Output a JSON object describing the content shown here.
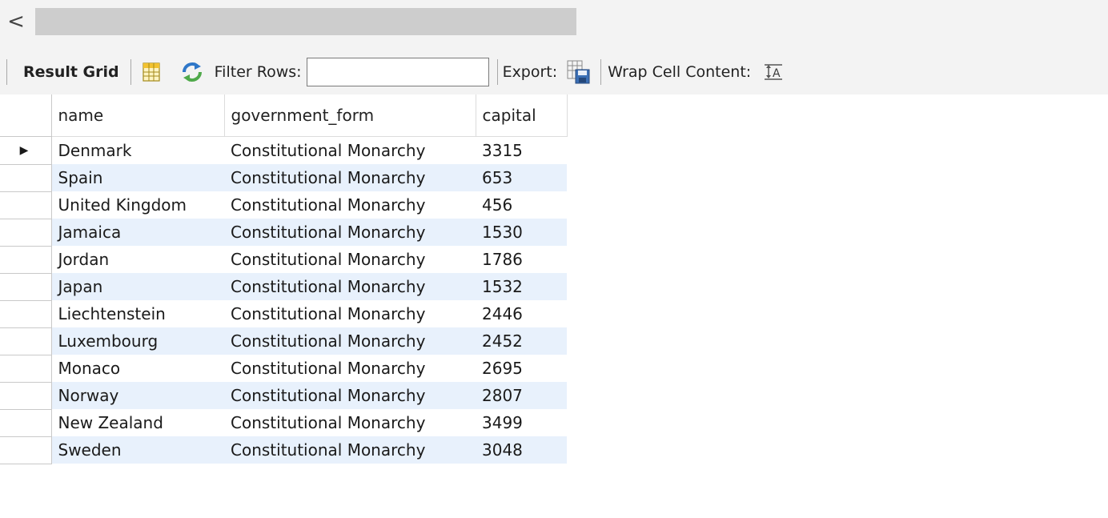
{
  "scrollbar": {
    "left_arrow": "<"
  },
  "toolbar": {
    "result_grid_label": "Result Grid",
    "filter_rows_label": "Filter Rows:",
    "filter_rows_value": "",
    "export_label": "Export:",
    "wrap_cell_label": "Wrap Cell Content:",
    "icons": [
      "grid-layout-icon",
      "refresh-icon",
      "export-icon",
      "wrap-text-icon"
    ]
  },
  "grid": {
    "columns": [
      "name",
      "government_form",
      "capital"
    ],
    "current_row_marker": "▶",
    "rows": [
      {
        "name": "Denmark",
        "government_form": "Constitutional Monarchy",
        "capital": "3315"
      },
      {
        "name": "Spain",
        "government_form": "Constitutional Monarchy",
        "capital": "653"
      },
      {
        "name": "United Kingdom",
        "government_form": "Constitutional Monarchy",
        "capital": "456"
      },
      {
        "name": "Jamaica",
        "government_form": "Constitutional Monarchy",
        "capital": "1530"
      },
      {
        "name": "Jordan",
        "government_form": "Constitutional Monarchy",
        "capital": "1786"
      },
      {
        "name": "Japan",
        "government_form": "Constitutional Monarchy",
        "capital": "1532"
      },
      {
        "name": "Liechtenstein",
        "government_form": "Constitutional Monarchy",
        "capital": "2446"
      },
      {
        "name": "Luxembourg",
        "government_form": "Constitutional Monarchy",
        "capital": "2452"
      },
      {
        "name": "Monaco",
        "government_form": "Constitutional Monarchy",
        "capital": "2695"
      },
      {
        "name": "Norway",
        "government_form": "Constitutional Monarchy",
        "capital": "2807"
      },
      {
        "name": "New Zealand",
        "government_form": "Constitutional Monarchy",
        "capital": "3499"
      },
      {
        "name": "Sweden",
        "government_form": "Constitutional Monarchy",
        "capital": "3048"
      }
    ]
  },
  "colors": {
    "alt_row": "#e8f1fc",
    "toolbar_bg": "#f3f3f3",
    "scroll_thumb": "#cdcdcd"
  }
}
